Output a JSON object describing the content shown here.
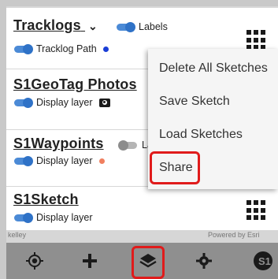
{
  "layers": [
    {
      "title": "Tracklogs",
      "toggle1_label": "Labels",
      "toggle2_label": "Tracklog Path",
      "dot_color": "#1a3ed6"
    },
    {
      "title": "S1GeoTag Photos",
      "row_label": "Display layer"
    },
    {
      "title": "S1Waypoints",
      "toggle1_label": "Lab",
      "row_label": "Display layer",
      "dot_color": "#f07f5f"
    },
    {
      "title": "S1Sketch",
      "row_label": "Display layer"
    }
  ],
  "menu": {
    "items": [
      "Delete All Sketches",
      "Save Sketch",
      "Load Sketches",
      "Share"
    ]
  },
  "footer": {
    "left_text": "kelley",
    "right_text": "Powered by Esri"
  },
  "toolbar": {
    "icons": [
      "location-icon",
      "add-icon",
      "layers-icon",
      "settings-icon",
      "s1-logo-icon"
    ]
  },
  "colors": {
    "toggle_on": "#2f72c7",
    "highlight": "#e01b1b",
    "toolbar_bg": "#8f8f8f"
  }
}
